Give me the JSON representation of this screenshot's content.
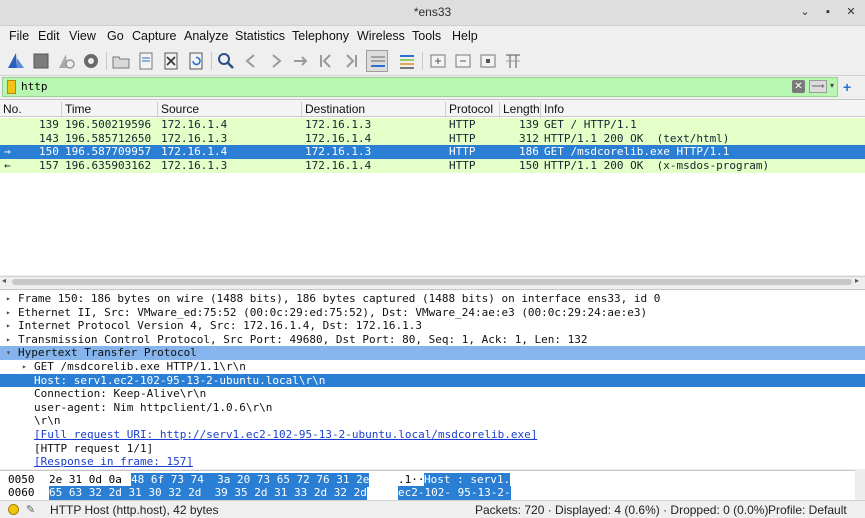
{
  "window": {
    "title": "*ens33",
    "min_label": "⌄",
    "max_label": "▪",
    "close_label": "✕"
  },
  "menu": [
    "File",
    "Edit",
    "View",
    "Go",
    "Capture",
    "Analyze",
    "Statistics",
    "Telephony",
    "Wireless",
    "Tools",
    "Help"
  ],
  "toolbar_icons": [
    "shark-fin-start-icon",
    "stop-square-icon",
    "restart-fin-icon",
    "capture-options-gear-icon",
    "open-folder-icon",
    "save-file-icon",
    "close-file-icon",
    "reload-icon",
    "find-magnifier-icon",
    "go-back-icon",
    "go-forward-icon",
    "go-first-icon",
    "go-last-icon",
    "autoscroll-icon",
    "colorize-icon",
    "zoom-in-icon",
    "zoom-out-icon",
    "zoom-normal-icon",
    "resize-columns-icon"
  ],
  "filter": {
    "value": "http",
    "clear_label": "✕",
    "apply_label": "⟶",
    "dropdown_label": "▾",
    "add_label": "+"
  },
  "packet_list": {
    "columns": [
      "No.",
      "Time",
      "Source",
      "Destination",
      "Protocol",
      "Length",
      "Info"
    ],
    "rows": [
      {
        "no": "139",
        "time": "196.500219596",
        "src": "172.16.1.4",
        "dst": "172.16.1.3",
        "proto": "HTTP",
        "len": "139",
        "info": "GET / HTTP/1.1",
        "state": "http",
        "mark": ""
      },
      {
        "no": "143",
        "time": "196.585712650",
        "src": "172.16.1.3",
        "dst": "172.16.1.4",
        "proto": "HTTP",
        "len": "312",
        "info": "HTTP/1.1 200 OK  (text/html)",
        "state": "http",
        "mark": ""
      },
      {
        "no": "150",
        "time": "196.587709957",
        "src": "172.16.1.4",
        "dst": "172.16.1.3",
        "proto": "HTTP",
        "len": "186",
        "info": "GET /msdcorelib.exe HTTP/1.1",
        "state": "sel",
        "mark": "→"
      },
      {
        "no": "157",
        "time": "196.635903162",
        "src": "172.16.1.3",
        "dst": "172.16.1.4",
        "proto": "HTTP",
        "len": "150",
        "info": "HTTP/1.1 200 OK  (x-msdos-program)",
        "state": "http",
        "mark": "←"
      }
    ]
  },
  "details": [
    {
      "indent": 0,
      "twisty": "▸",
      "text": "Frame 150: 186 bytes on wire (1488 bits), 186 bytes captured (1488 bits) on interface ens33, id 0",
      "style": ""
    },
    {
      "indent": 0,
      "twisty": "▸",
      "text": "Ethernet II, Src: VMware_ed:75:52 (00:0c:29:ed:75:52), Dst: VMware_24:ae:e3 (00:0c:29:24:ae:e3)",
      "style": ""
    },
    {
      "indent": 0,
      "twisty": "▸",
      "text": "Internet Protocol Version 4, Src: 172.16.1.4, Dst: 172.16.1.3",
      "style": ""
    },
    {
      "indent": 0,
      "twisty": "▸",
      "text": "Transmission Control Protocol, Src Port: 49680, Dst Port: 80, Seq: 1, Ack: 1, Len: 132",
      "style": ""
    },
    {
      "indent": 0,
      "twisty": "▾",
      "text": "Hypertext Transfer Protocol",
      "style": "hl"
    },
    {
      "indent": 1,
      "twisty": "▸",
      "text": "GET /msdcorelib.exe HTTP/1.1\\r\\n",
      "style": ""
    },
    {
      "indent": 1,
      "twisty": "",
      "text": "Host: serv1.ec2-102-95-13-2-ubuntu.local\\r\\n",
      "style": "sel"
    },
    {
      "indent": 1,
      "twisty": "",
      "text": "Connection: Keep-Alive\\r\\n",
      "style": ""
    },
    {
      "indent": 1,
      "twisty": "",
      "text": "user-agent: Nim httpclient/1.0.6\\r\\n",
      "style": ""
    },
    {
      "indent": 1,
      "twisty": "",
      "text": "\\r\\n",
      "style": ""
    },
    {
      "indent": 1,
      "twisty": "",
      "text": "[Full request URI: http://serv1.ec2-102-95-13-2-ubuntu.local/msdcorelib.exe]",
      "style": "link"
    },
    {
      "indent": 1,
      "twisty": "",
      "text": "[HTTP request 1/1]",
      "style": ""
    },
    {
      "indent": 1,
      "twisty": "",
      "text": "[Response in frame: 157]",
      "style": "link"
    }
  ],
  "bytes": [
    {
      "offset": "0050",
      "hex_plain": "2e 31 0d 0a ",
      "hex_sel": "48 6f 73 74  3a 20 73 65 72 76 31 2e",
      "ascii_plain": ".1··",
      "ascii_sel": "Host : serv1."
    },
    {
      "offset": "0060",
      "hex_plain": "",
      "hex_sel": "65 63 32 2d 31 30 32 2d  39 35 2d 31 33 2d 32 2d",
      "ascii_plain": "",
      "ascii_sel": "ec2-102- 95-13-2-"
    }
  ],
  "status": {
    "field": "HTTP Host (http.host), 42 bytes",
    "packets": "Packets: 720 · Displayed: 4 (0.6%) · Dropped: 0 (0.0%)",
    "profile": "Profile: Default"
  }
}
